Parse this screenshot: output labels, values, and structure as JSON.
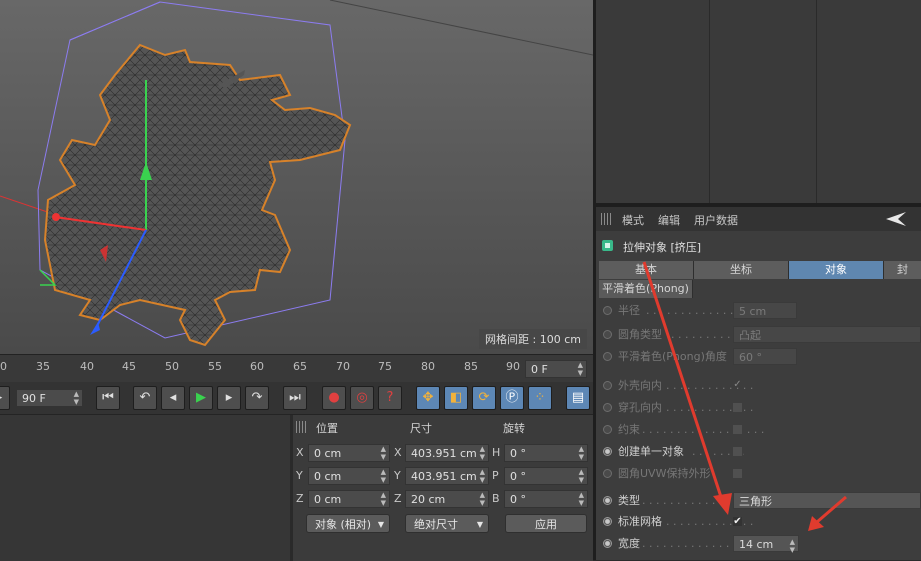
{
  "viewport": {
    "grid_spacing": "网格间距 : 100 cm"
  },
  "timeline": {
    "ticks": [
      "0",
      "35",
      "40",
      "45",
      "50",
      "55",
      "60",
      "65",
      "70",
      "75",
      "80",
      "85",
      "90"
    ],
    "current_frame": "0 F",
    "end_frame": "90 F"
  },
  "coords": {
    "headers": {
      "position": "位置",
      "size": "尺寸",
      "rotation": "旋转"
    },
    "rows": [
      {
        "axis": "X",
        "pos": "0 cm",
        "size_axis": "X",
        "size": "403.951 cm",
        "rot_axis": "H",
        "rot": "0 °"
      },
      {
        "axis": "Y",
        "pos": "0 cm",
        "size_axis": "Y",
        "size": "403.951 cm",
        "rot_axis": "P",
        "rot": "0 °"
      },
      {
        "axis": "Z",
        "pos": "0 cm",
        "size_axis": "Z",
        "size": "20 cm",
        "rot_axis": "B",
        "rot": "0 °"
      }
    ],
    "mode_select": "对象 (相对)",
    "size_select": "绝对尺寸",
    "apply": "应用"
  },
  "attributes": {
    "menu": [
      "模式",
      "编辑",
      "用户数据"
    ],
    "object_title": "拉伸对象 [挤压]",
    "tabs": [
      "基本",
      "坐标",
      "对象",
      "封"
    ],
    "active_tab": "对象",
    "phong_tab": "平滑着色(Phong)",
    "props": [
      {
        "label": "半径",
        "value": "5 cm",
        "kind": "field",
        "enabled": false
      },
      {
        "label": "圆角类型",
        "value": "凸起",
        "kind": "select",
        "enabled": false
      },
      {
        "label": "平滑着色(Phong)角度",
        "value": "60 °",
        "kind": "field",
        "enabled": false
      },
      {
        "label": "外壳向内",
        "value": "✓",
        "kind": "check",
        "enabled": false
      },
      {
        "label": "穿孔向内",
        "value": "",
        "kind": "check",
        "enabled": false
      },
      {
        "label": "约束",
        "value": "",
        "kind": "check",
        "enabled": false
      },
      {
        "label": "创建单一对象",
        "value": "",
        "kind": "check",
        "enabled": true
      },
      {
        "label": "圆角UVW保持外形",
        "value": "",
        "kind": "check",
        "enabled": false
      },
      {
        "label": "类型",
        "value": "三角形",
        "kind": "select",
        "enabled": true
      },
      {
        "label": "标准网格",
        "value": "✔",
        "kind": "check",
        "enabled": true
      },
      {
        "label": "宽度",
        "value": "14 cm",
        "kind": "field",
        "enabled": true
      }
    ]
  },
  "colors": {
    "accent_tab": "#5f87b0",
    "annotation_arrow": "#e03b2e",
    "object_outline": "#d7822a"
  }
}
